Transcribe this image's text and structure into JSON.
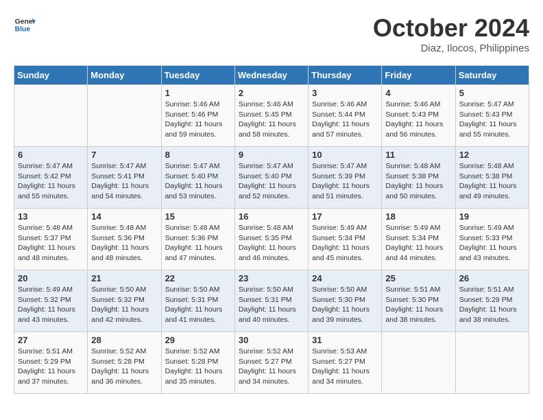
{
  "header": {
    "logo_line1": "General",
    "logo_line2": "Blue",
    "month": "October 2024",
    "location": "Diaz, Ilocos, Philippines"
  },
  "days_of_week": [
    "Sunday",
    "Monday",
    "Tuesday",
    "Wednesday",
    "Thursday",
    "Friday",
    "Saturday"
  ],
  "weeks": [
    [
      {
        "day": "",
        "detail": ""
      },
      {
        "day": "",
        "detail": ""
      },
      {
        "day": "1",
        "detail": "Sunrise: 5:46 AM\nSunset: 5:46 PM\nDaylight: 11 hours and 59 minutes."
      },
      {
        "day": "2",
        "detail": "Sunrise: 5:46 AM\nSunset: 5:45 PM\nDaylight: 11 hours and 58 minutes."
      },
      {
        "day": "3",
        "detail": "Sunrise: 5:46 AM\nSunset: 5:44 PM\nDaylight: 11 hours and 57 minutes."
      },
      {
        "day": "4",
        "detail": "Sunrise: 5:46 AM\nSunset: 5:43 PM\nDaylight: 11 hours and 56 minutes."
      },
      {
        "day": "5",
        "detail": "Sunrise: 5:47 AM\nSunset: 5:43 PM\nDaylight: 11 hours and 55 minutes."
      }
    ],
    [
      {
        "day": "6",
        "detail": "Sunrise: 5:47 AM\nSunset: 5:42 PM\nDaylight: 11 hours and 55 minutes."
      },
      {
        "day": "7",
        "detail": "Sunrise: 5:47 AM\nSunset: 5:41 PM\nDaylight: 11 hours and 54 minutes."
      },
      {
        "day": "8",
        "detail": "Sunrise: 5:47 AM\nSunset: 5:40 PM\nDaylight: 11 hours and 53 minutes."
      },
      {
        "day": "9",
        "detail": "Sunrise: 5:47 AM\nSunset: 5:40 PM\nDaylight: 11 hours and 52 minutes."
      },
      {
        "day": "10",
        "detail": "Sunrise: 5:47 AM\nSunset: 5:39 PM\nDaylight: 11 hours and 51 minutes."
      },
      {
        "day": "11",
        "detail": "Sunrise: 5:48 AM\nSunset: 5:38 PM\nDaylight: 11 hours and 50 minutes."
      },
      {
        "day": "12",
        "detail": "Sunrise: 5:48 AM\nSunset: 5:38 PM\nDaylight: 11 hours and 49 minutes."
      }
    ],
    [
      {
        "day": "13",
        "detail": "Sunrise: 5:48 AM\nSunset: 5:37 PM\nDaylight: 11 hours and 48 minutes."
      },
      {
        "day": "14",
        "detail": "Sunrise: 5:48 AM\nSunset: 5:36 PM\nDaylight: 11 hours and 48 minutes."
      },
      {
        "day": "15",
        "detail": "Sunrise: 5:48 AM\nSunset: 5:36 PM\nDaylight: 11 hours and 47 minutes."
      },
      {
        "day": "16",
        "detail": "Sunrise: 5:48 AM\nSunset: 5:35 PM\nDaylight: 11 hours and 46 minutes."
      },
      {
        "day": "17",
        "detail": "Sunrise: 5:49 AM\nSunset: 5:34 PM\nDaylight: 11 hours and 45 minutes."
      },
      {
        "day": "18",
        "detail": "Sunrise: 5:49 AM\nSunset: 5:34 PM\nDaylight: 11 hours and 44 minutes."
      },
      {
        "day": "19",
        "detail": "Sunrise: 5:49 AM\nSunset: 5:33 PM\nDaylight: 11 hours and 43 minutes."
      }
    ],
    [
      {
        "day": "20",
        "detail": "Sunrise: 5:49 AM\nSunset: 5:32 PM\nDaylight: 11 hours and 43 minutes."
      },
      {
        "day": "21",
        "detail": "Sunrise: 5:50 AM\nSunset: 5:32 PM\nDaylight: 11 hours and 42 minutes."
      },
      {
        "day": "22",
        "detail": "Sunrise: 5:50 AM\nSunset: 5:31 PM\nDaylight: 11 hours and 41 minutes."
      },
      {
        "day": "23",
        "detail": "Sunrise: 5:50 AM\nSunset: 5:31 PM\nDaylight: 11 hours and 40 minutes."
      },
      {
        "day": "24",
        "detail": "Sunrise: 5:50 AM\nSunset: 5:30 PM\nDaylight: 11 hours and 39 minutes."
      },
      {
        "day": "25",
        "detail": "Sunrise: 5:51 AM\nSunset: 5:30 PM\nDaylight: 11 hours and 38 minutes."
      },
      {
        "day": "26",
        "detail": "Sunrise: 5:51 AM\nSunset: 5:29 PM\nDaylight: 11 hours and 38 minutes."
      }
    ],
    [
      {
        "day": "27",
        "detail": "Sunrise: 5:51 AM\nSunset: 5:29 PM\nDaylight: 11 hours and 37 minutes."
      },
      {
        "day": "28",
        "detail": "Sunrise: 5:52 AM\nSunset: 5:28 PM\nDaylight: 11 hours and 36 minutes."
      },
      {
        "day": "29",
        "detail": "Sunrise: 5:52 AM\nSunset: 5:28 PM\nDaylight: 11 hours and 35 minutes."
      },
      {
        "day": "30",
        "detail": "Sunrise: 5:52 AM\nSunset: 5:27 PM\nDaylight: 11 hours and 34 minutes."
      },
      {
        "day": "31",
        "detail": "Sunrise: 5:53 AM\nSunset: 5:27 PM\nDaylight: 11 hours and 34 minutes."
      },
      {
        "day": "",
        "detail": ""
      },
      {
        "day": "",
        "detail": ""
      }
    ]
  ]
}
